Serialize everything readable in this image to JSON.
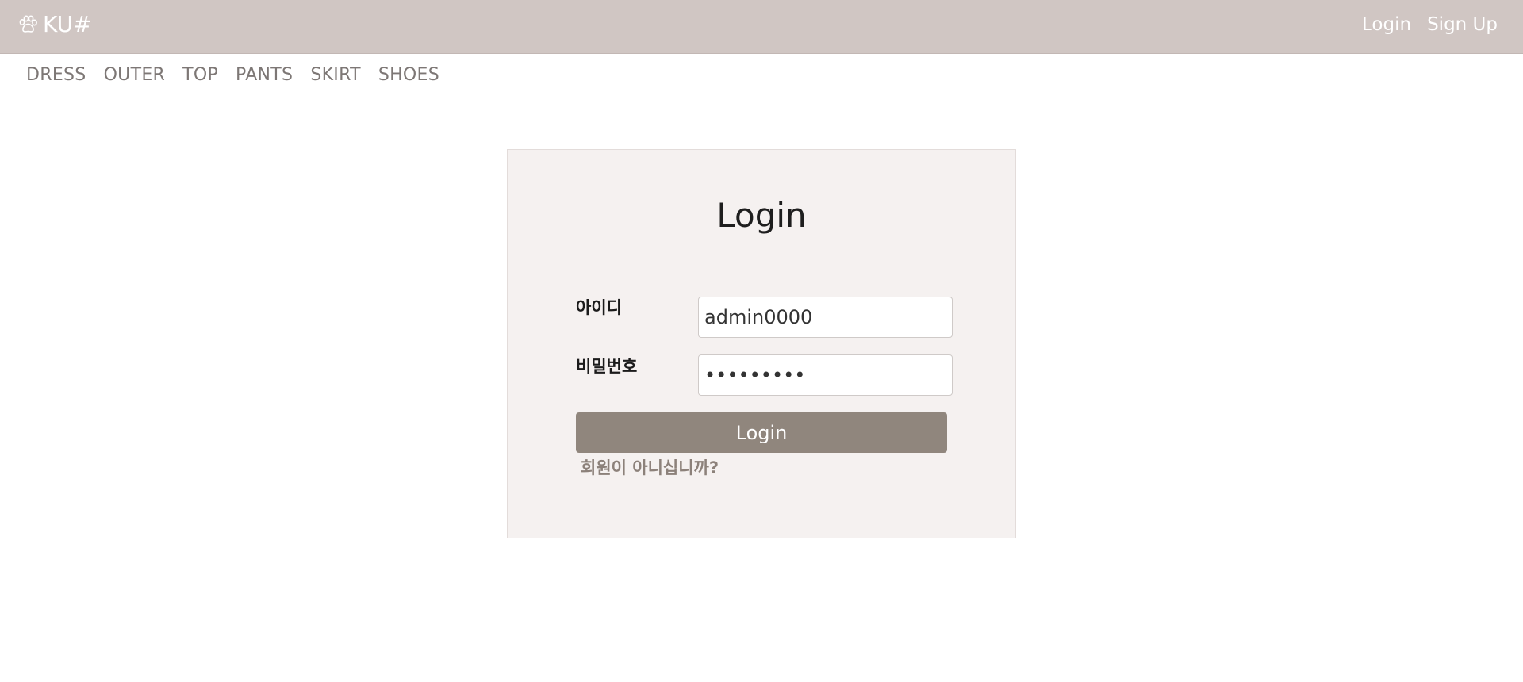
{
  "header": {
    "brand": "KU#",
    "brand_icon": "paw-icon",
    "links": {
      "login": "Login",
      "signup": "Sign Up"
    },
    "background_color": "#d0c6c3"
  },
  "categories": [
    "DRESS",
    "OUTER",
    "TOP",
    "PANTS",
    "SKIRT",
    "SHOES"
  ],
  "login_form": {
    "title": "Login",
    "id_label": "아이디",
    "id_value": "admin0000",
    "password_label": "비밀번호",
    "password_value": "•••••••••",
    "submit_label": "Login",
    "signup_hint": "회원이 아니십니까?",
    "button_color": "#90867d"
  }
}
